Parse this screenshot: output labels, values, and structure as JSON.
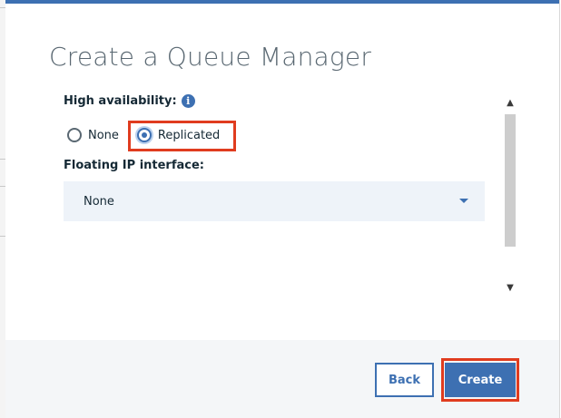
{
  "dialog": {
    "title": "Create a Queue Manager"
  },
  "high_availability": {
    "label": "High availability:",
    "info_icon": "info-icon",
    "options": [
      {
        "label": "None",
        "selected": false
      },
      {
        "label": "Replicated",
        "selected": true
      }
    ]
  },
  "floating_ip": {
    "label": "Floating IP interface:",
    "selected_value": "None",
    "caret_icon": "chevron-down-icon"
  },
  "footer": {
    "back_label": "Back",
    "create_label": "Create"
  },
  "colors": {
    "accent": "#3d70b2",
    "highlight": "#e03c1f",
    "select_bg": "#eef3f9",
    "footer_bg": "#f4f6f8"
  }
}
